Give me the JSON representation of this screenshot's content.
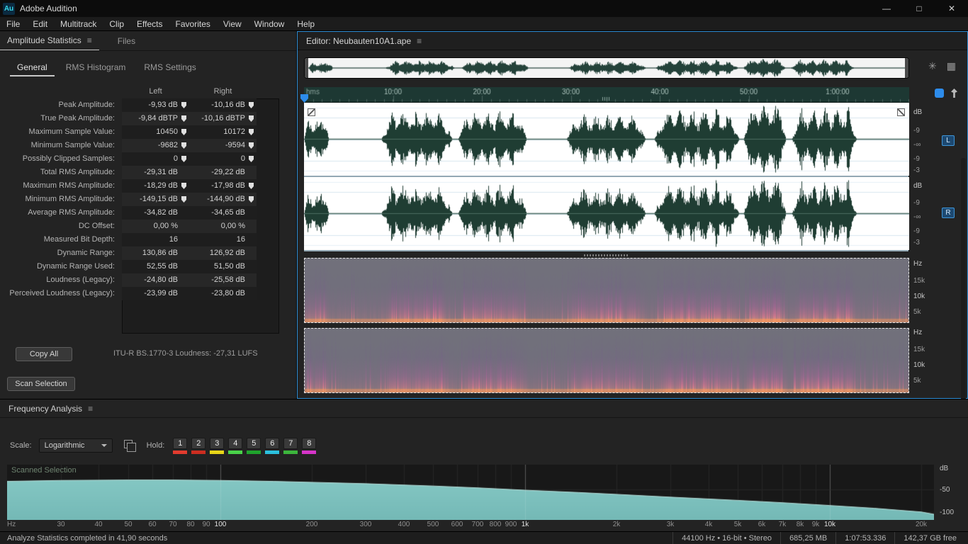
{
  "icons": {
    "panel_menu": "≡",
    "nav_icon": "✳",
    "grid_icon": "▦"
  },
  "titlebar": {
    "logo": "Au",
    "app": "Adobe Audition",
    "minimize": "—",
    "maximize": "□",
    "close": "✕"
  },
  "menubar": {
    "items": [
      "File",
      "Edit",
      "Multitrack",
      "Clip",
      "Effects",
      "Favorites",
      "View",
      "Window",
      "Help"
    ]
  },
  "stats_panel": {
    "tabs": [
      {
        "label": "Amplitude Statistics",
        "active": true
      },
      {
        "label": "Files",
        "active": false
      }
    ],
    "subtabs": [
      {
        "label": "General",
        "active": true
      },
      {
        "label": "RMS Histogram",
        "active": false
      },
      {
        "label": "RMS Settings",
        "active": false
      }
    ],
    "columns": {
      "left": "Left",
      "right": "Right"
    },
    "rows": [
      {
        "label": "Peak Amplitude:",
        "left": "-9,93 dB",
        "right": "-10,16 dB",
        "marker": true
      },
      {
        "label": "True Peak Amplitude:",
        "left": "-9,84 dBTP",
        "right": "-10,16 dBTP",
        "marker": true
      },
      {
        "label": "Maximum Sample Value:",
        "left": "10450",
        "right": "10172",
        "marker": true
      },
      {
        "label": "Minimum Sample Value:",
        "left": "-9682",
        "right": "-9594",
        "marker": true
      },
      {
        "label": "Possibly Clipped Samples:",
        "left": "0",
        "right": "0",
        "marker": true
      },
      {
        "label": "Total RMS Amplitude:",
        "left": "-29,31 dB",
        "right": "-29,22 dB",
        "marker": false
      },
      {
        "label": "Maximum RMS Amplitude:",
        "left": "-18,29 dB",
        "right": "-17,98 dB",
        "marker": true
      },
      {
        "label": "Minimum RMS Amplitude:",
        "left": "-149,15 dB",
        "right": "-144,90 dB",
        "marker": true
      },
      {
        "label": "Average RMS Amplitude:",
        "left": "-34,82 dB",
        "right": "-34,65 dB",
        "marker": false
      },
      {
        "label": "DC Offset:",
        "left": "0,00 %",
        "right": "0,00 %",
        "marker": false
      },
      {
        "label": "Measured Bit Depth:",
        "left": "16",
        "right": "16",
        "marker": false
      },
      {
        "label": "Dynamic Range:",
        "left": "130,86 dB",
        "right": "126,92 dB",
        "marker": false
      },
      {
        "label": "Dynamic Range Used:",
        "left": "52,55 dB",
        "right": "51,50 dB",
        "marker": false
      },
      {
        "label": "Loudness (Legacy):",
        "left": "-24,80 dB",
        "right": "-25,58 dB",
        "marker": false
      },
      {
        "label": "Perceived Loudness (Legacy):",
        "left": "-23,99 dB",
        "right": "-23,80 dB",
        "marker": false
      }
    ],
    "copy_all": "Copy All",
    "itu_loudness": "ITU-R BS.1770-3 Loudness:  -27,31 LUFS",
    "scan_selection": "Scan Selection"
  },
  "editor": {
    "tab": "Editor: Neubauten10A1.ape",
    "ruler_unit": "hms",
    "ruler_ticks": [
      "10:00",
      "20:00",
      "30:00",
      "40:00",
      "50:00",
      "1:00:00"
    ],
    "db_scale": [
      "dB",
      "-9",
      "-∞",
      "-9",
      "-3"
    ],
    "hz_scale": [
      "Hz",
      "15k",
      "10k",
      "5k"
    ],
    "channels": [
      "L",
      "R"
    ]
  },
  "frequency_panel": {
    "tab": "Frequency Analysis",
    "scale_label": "Scale:",
    "scale_value": "Logarithmic",
    "hold_label": "Hold:",
    "hold_buttons": [
      {
        "label": "1",
        "color": "#e23b2e"
      },
      {
        "label": "2",
        "color": "#cc2d20"
      },
      {
        "label": "3",
        "color": "#e7d518"
      },
      {
        "label": "4",
        "color": "#49d249"
      },
      {
        "label": "5",
        "color": "#1fa32c"
      },
      {
        "label": "6",
        "color": "#2bc0dd"
      },
      {
        "label": "7",
        "color": "#3cb53c"
      },
      {
        "label": "8",
        "color": "#d534c8"
      }
    ],
    "graph_label": "Scanned Selection",
    "x_unit": "Hz"
  },
  "chart_data": {
    "type": "area",
    "title": "Frequency Analysis - Scanned Selection",
    "xlabel": "Hz",
    "ylabel": "dB",
    "x_scale": "log",
    "xlim": [
      20,
      22000
    ],
    "ylim": [
      -110,
      0
    ],
    "grid": true,
    "fill_color": "#74b9b6",
    "x": [
      20,
      30,
      50,
      70,
      100,
      150,
      200,
      300,
      500,
      700,
      1000,
      1500,
      2000,
      3000,
      5000,
      7000,
      10000,
      14000,
      20000,
      22000
    ],
    "y": [
      -33,
      -31,
      -30,
      -30,
      -31,
      -33,
      -35,
      -38,
      -43,
      -47,
      -52,
      -57,
      -61,
      -67,
      -74,
      -79,
      -85,
      -91,
      -99,
      -104
    ],
    "x_ticks": [
      "30",
      "40",
      "50",
      "60",
      "70",
      "80",
      "90",
      "100",
      "200",
      "300",
      "400",
      "500",
      "600",
      "700",
      "800",
      "900",
      "1k",
      "2k",
      "3k",
      "4k",
      "5k",
      "6k",
      "7k",
      "8k",
      "9k",
      "10k",
      "20k"
    ],
    "x_tick_values": [
      30,
      40,
      50,
      60,
      70,
      80,
      90,
      100,
      200,
      300,
      400,
      500,
      600,
      700,
      800,
      900,
      1000,
      2000,
      3000,
      4000,
      5000,
      6000,
      7000,
      8000,
      9000,
      10000,
      20000
    ],
    "major_ticks": [
      "100",
      "1k",
      "10k"
    ],
    "y_ticks": [
      {
        "label": "dB",
        "db": 0
      },
      {
        "label": "-50",
        "db": -50
      },
      {
        "label": "-100",
        "db": -100
      }
    ]
  },
  "statusbar": {
    "left": "Analyze Statistics completed in 41,90 seconds",
    "items": [
      "44100 Hz • 16-bit • Stereo",
      "685,25 MB",
      "1:07:53.336",
      "142,37 GB free"
    ]
  }
}
